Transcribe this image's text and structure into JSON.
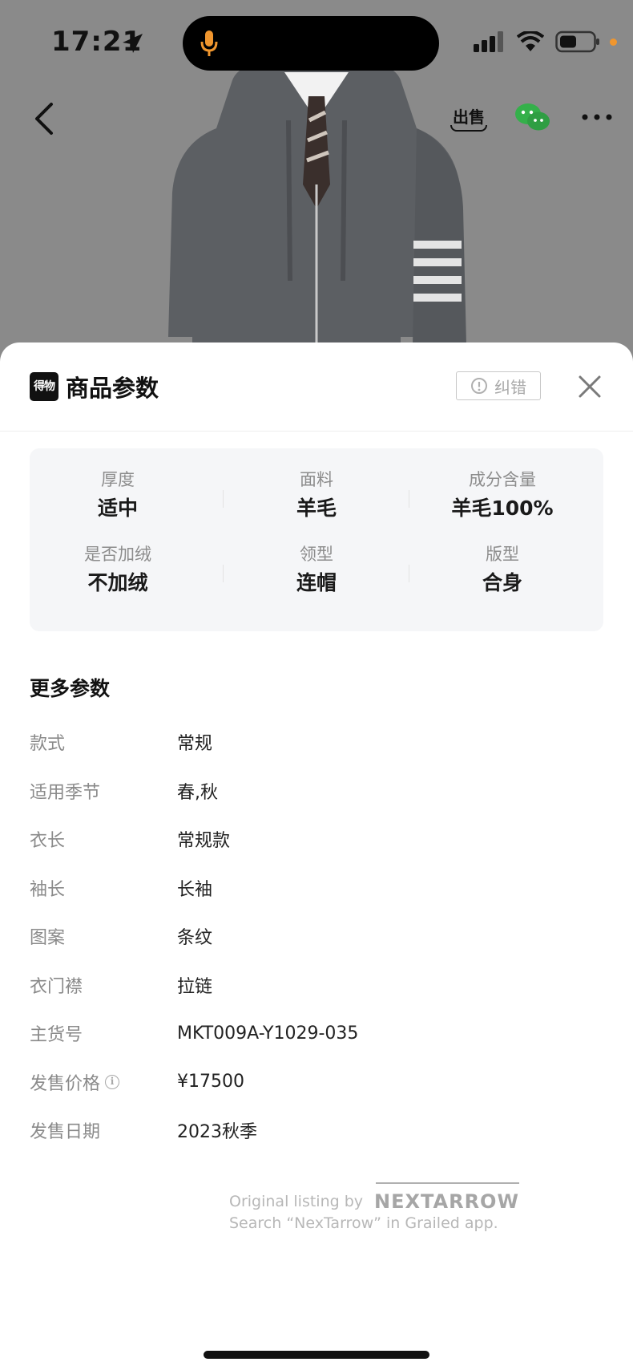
{
  "status_bar": {
    "time": "17:21"
  },
  "sheet": {
    "title": "商品参数",
    "app_logo_text": "得物",
    "report_label": "纠错"
  },
  "key_params": [
    {
      "label": "厚度",
      "value": "适中"
    },
    {
      "label": "面料",
      "value": "羊毛"
    },
    {
      "label": "成分含量",
      "value": "羊毛100%"
    },
    {
      "label": "是否加绒",
      "value": "不加绒"
    },
    {
      "label": "领型",
      "value": "连帽"
    },
    {
      "label": "版型",
      "value": "合身"
    }
  ],
  "more_params": {
    "title": "更多参数",
    "rows": [
      {
        "label": "款式",
        "value": "常规"
      },
      {
        "label": "适用季节",
        "value": "春,秋"
      },
      {
        "label": "衣长",
        "value": "常规款"
      },
      {
        "label": "袖长",
        "value": "长袖"
      },
      {
        "label": "图案",
        "value": "条纹"
      },
      {
        "label": "衣门襟",
        "value": "拉链"
      },
      {
        "label": "主货号",
        "value": "MKT009A-Y1029-035"
      },
      {
        "label": "发售价格",
        "value": "¥17500"
      },
      {
        "label": "发售日期",
        "value": "2023秋季"
      }
    ]
  },
  "watermark": {
    "line1": "Original listing by",
    "brand": "NEXTARROW",
    "line2": "Search “NexTarrow” in Grailed app."
  },
  "nav": {
    "sell_label": "出售"
  },
  "colors": {
    "sheet_bg": "#ffffff",
    "card_bg": "#f5f6f8",
    "backdrop": "#8a8a8a",
    "battery_dot": "#f0962e"
  }
}
